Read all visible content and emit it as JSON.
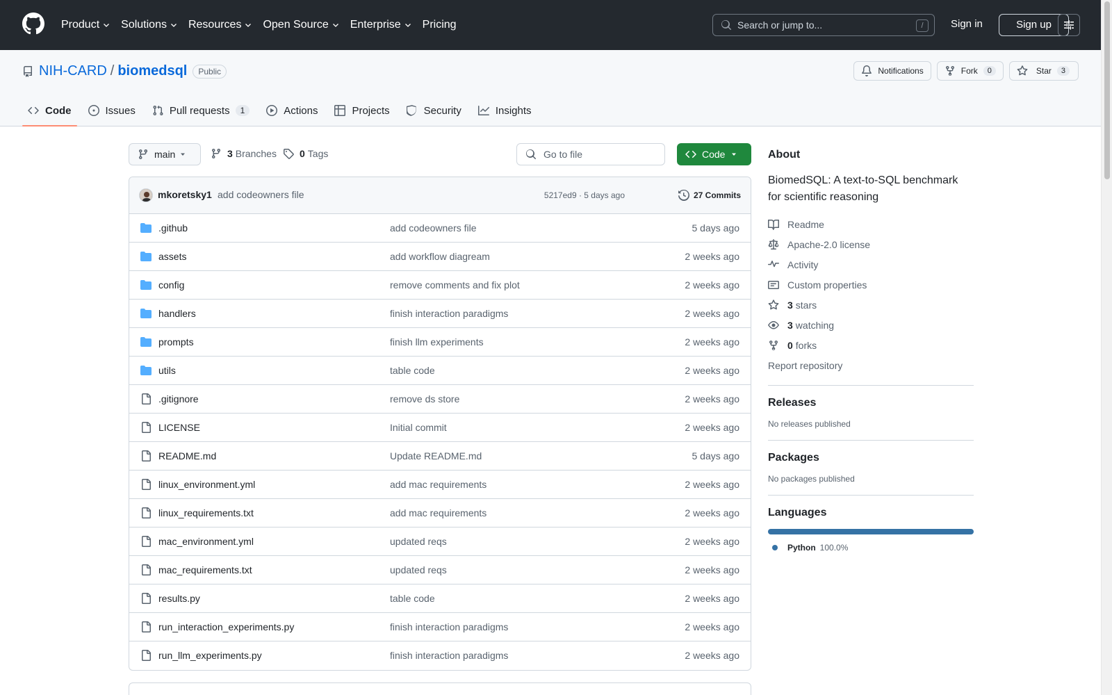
{
  "header": {
    "nav": [
      {
        "label": "Product",
        "dropdown": true
      },
      {
        "label": "Solutions",
        "dropdown": true
      },
      {
        "label": "Resources",
        "dropdown": true
      },
      {
        "label": "Open Source",
        "dropdown": true
      },
      {
        "label": "Enterprise",
        "dropdown": true
      },
      {
        "label": "Pricing",
        "dropdown": false
      }
    ],
    "search_placeholder": "Search or jump to...",
    "search_shortcut": "/",
    "sign_in": "Sign in",
    "sign_up": "Sign up"
  },
  "repo": {
    "owner": "NIH-CARD",
    "separator": "/",
    "name": "biomedsql",
    "visibility": "Public",
    "notifications_label": "Notifications",
    "fork_label": "Fork",
    "fork_count": "0",
    "star_label": "Star",
    "star_count": "3"
  },
  "tabs": [
    {
      "label": "Code",
      "icon": "code-icon",
      "active": true,
      "count": ""
    },
    {
      "label": "Issues",
      "icon": "issue-icon",
      "active": false,
      "count": ""
    },
    {
      "label": "Pull requests",
      "icon": "pull-request-icon",
      "active": false,
      "count": "1"
    },
    {
      "label": "Actions",
      "icon": "play-icon",
      "active": false,
      "count": ""
    },
    {
      "label": "Projects",
      "icon": "table-icon",
      "active": false,
      "count": ""
    },
    {
      "label": "Security",
      "icon": "shield-icon",
      "active": false,
      "count": ""
    },
    {
      "label": "Insights",
      "icon": "graph-icon",
      "active": false,
      "count": ""
    }
  ],
  "toolbar": {
    "branch": "main",
    "branches_count": "3",
    "branches_label": "Branches",
    "tags_count": "0",
    "tags_label": "Tags",
    "goto_placeholder": "Go to file",
    "code_button": "Code"
  },
  "latest_commit": {
    "author": "mkoretsky1",
    "message": "add codeowners file",
    "meta": "5217ed9 · 5 days ago",
    "commits_label": "27 Commits"
  },
  "files": [
    {
      "name": ".github",
      "type": "folder",
      "message": "add codeowners file",
      "date": "5 days ago"
    },
    {
      "name": "assets",
      "type": "folder",
      "message": "add workflow diagream",
      "date": "2 weeks ago"
    },
    {
      "name": "config",
      "type": "folder",
      "message": "remove comments and fix plot",
      "date": "2 weeks ago"
    },
    {
      "name": "handlers",
      "type": "folder",
      "message": "finish interaction paradigms",
      "date": "2 weeks ago"
    },
    {
      "name": "prompts",
      "type": "folder",
      "message": "finish llm experiments",
      "date": "2 weeks ago"
    },
    {
      "name": "utils",
      "type": "folder",
      "message": "table code",
      "date": "2 weeks ago"
    },
    {
      "name": ".gitignore",
      "type": "file",
      "message": "remove ds store",
      "date": "2 weeks ago"
    },
    {
      "name": "LICENSE",
      "type": "file",
      "message": "Initial commit",
      "date": "2 weeks ago"
    },
    {
      "name": "README.md",
      "type": "file",
      "message": "Update README.md",
      "date": "5 days ago"
    },
    {
      "name": "linux_environment.yml",
      "type": "file",
      "message": "add mac requirements",
      "date": "2 weeks ago"
    },
    {
      "name": "linux_requirements.txt",
      "type": "file",
      "message": "add mac requirements",
      "date": "2 weeks ago"
    },
    {
      "name": "mac_environment.yml",
      "type": "file",
      "message": "updated reqs",
      "date": "2 weeks ago"
    },
    {
      "name": "mac_requirements.txt",
      "type": "file",
      "message": "updated reqs",
      "date": "2 weeks ago"
    },
    {
      "name": "results.py",
      "type": "file",
      "message": "table code",
      "date": "2 weeks ago"
    },
    {
      "name": "run_interaction_experiments.py",
      "type": "file",
      "message": "finish interaction paradigms",
      "date": "2 weeks ago"
    },
    {
      "name": "run_llm_experiments.py",
      "type": "file",
      "message": "finish interaction paradigms",
      "date": "2 weeks ago"
    }
  ],
  "about": {
    "heading": "About",
    "description": "BiomedSQL: A text-to-SQL benchmark for scientific reasoning",
    "readme": "Readme",
    "license": "Apache-2.0 license",
    "activity": "Activity",
    "custom_properties": "Custom properties",
    "stars_count": "3",
    "stars_label": "stars",
    "watching_count": "3",
    "watching_label": "watching",
    "forks_count": "0",
    "forks_label": "forks",
    "report": "Report repository"
  },
  "releases": {
    "heading": "Releases",
    "empty": "No releases published"
  },
  "packages": {
    "heading": "Packages",
    "empty": "No packages published"
  },
  "languages": {
    "heading": "Languages",
    "items": [
      {
        "name": "Python",
        "percent": "100.0%",
        "fraction": 1.0,
        "color": "#3572A5"
      }
    ]
  },
  "colors": {
    "accent": "#0969da",
    "primary_button": "#1f883d",
    "active_tab_underline": "#fd8c73",
    "header_bg": "#24292f",
    "folder": "#54aeff"
  }
}
